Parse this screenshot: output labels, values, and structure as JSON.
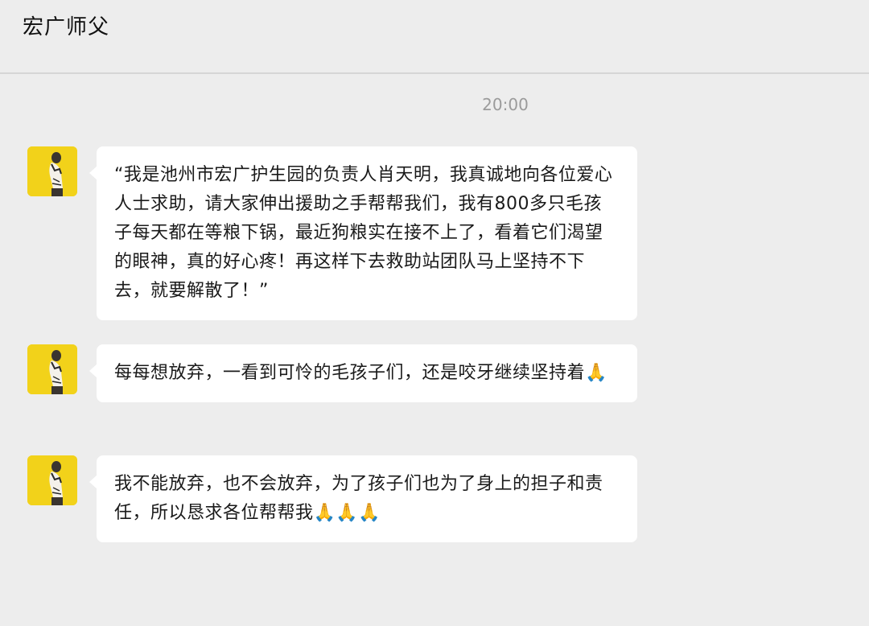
{
  "header": {
    "title": "宏广师父"
  },
  "timestamp": "20:00",
  "messages": [
    {
      "sender_avatar": "yellow-avatar-monk",
      "text": "“我是池州市宏广护生园的负责人肖天明，我真诚地向各位爱心人士求助，请大家伸出援助之手帮帮我们，我有800多只毛孩子每天都在等粮下锅，最近狗粮实在接不上了，看着它们渴望的眼神，真的好心疼！再这样下去救助站团队马上坚持不下去，就要解散了！”"
    },
    {
      "sender_avatar": "yellow-avatar-monk",
      "text": "每每想放弃，一看到可怜的毛孩子们，还是咬牙继续坚持着🙏"
    },
    {
      "sender_avatar": "yellow-avatar-monk",
      "text": "我不能放弃，也不会放弃，为了孩子们也为了身上的担子和责任，所以恳求各位帮帮我🙏🙏🙏"
    }
  ],
  "colors": {
    "background": "#ededed",
    "bubble": "#ffffff",
    "avatar_bg": "#f2d21a",
    "timestamp": "#9b9b9b"
  }
}
